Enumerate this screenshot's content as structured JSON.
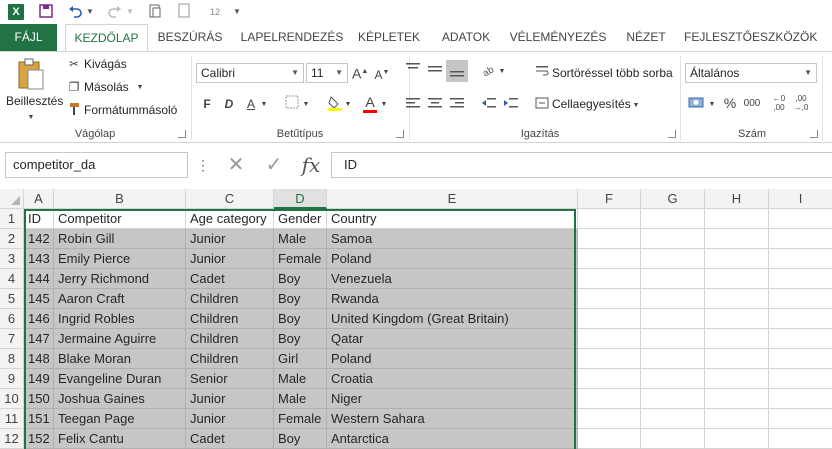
{
  "qat": {
    "app_icon": "X",
    "save_icon": "save-icon",
    "undo_icon": "undo-icon",
    "redo_icon": "redo-icon",
    "print_preview_icon": "print-preview-icon",
    "new_icon": "new-file-icon",
    "calendar_label": "12"
  },
  "tabs": [
    "FÁJL",
    "KEZDŐLAP",
    "BESZÚRÁS",
    "LAPELRENDEZÉS",
    "KÉPLETEK",
    "ADATOK",
    "VÉLEMÉNYEZÉS",
    "NÉZET",
    "FEJLESZTŐESZKÖZÖK"
  ],
  "ribbon": {
    "clipboard": {
      "paste": "Beillesztés",
      "cut": "Kivágás",
      "copy": "Másolás",
      "format_painter": "Formátummásoló",
      "label": "Vágólap"
    },
    "font": {
      "name": "Calibri",
      "size": "11",
      "grow": "A",
      "shrink": "A",
      "bold": "F",
      "italic": "D",
      "underline": "A",
      "font_color": "A",
      "label": "Betűtípus",
      "fill_color": "#ffff00",
      "text_color": "#ff0000"
    },
    "alignment": {
      "sort_label": "Sortöréssel több sorba",
      "merge_label": "Cellaegyesítés",
      "label": "Igazítás"
    },
    "number": {
      "format": "Általános",
      "percent": "%",
      "thousands": "000",
      "label": "Szám"
    }
  },
  "formula_bar": {
    "name_box": "competitor_da",
    "formula": "ID",
    "fx": "fx"
  },
  "columns": [
    "A",
    "B",
    "C",
    "D",
    "E",
    "F",
    "G",
    "H",
    "I"
  ],
  "selected_column": "D",
  "rows": [
    [
      "ID",
      "Competitor",
      "Age category",
      "Gender",
      "Country"
    ],
    [
      "142",
      "Robin Gill",
      "Junior",
      "Male",
      "Samoa"
    ],
    [
      "143",
      "Emily Pierce",
      "Junior",
      "Female",
      "Poland"
    ],
    [
      "144",
      "Jerry Richmond",
      "Cadet",
      "Boy",
      "Venezuela"
    ],
    [
      "145",
      "Aaron Craft",
      "Children",
      "Boy",
      "Rwanda"
    ],
    [
      "146",
      "Ingrid Robles",
      "Children",
      "Boy",
      "United Kingdom (Great Britain)"
    ],
    [
      "147",
      "Jermaine Aguirre",
      "Children",
      "Boy",
      "Qatar"
    ],
    [
      "148",
      "Blake Moran",
      "Children",
      "Girl",
      "Poland"
    ],
    [
      "149",
      "Evangeline Duran",
      "Senior",
      "Male",
      "Croatia"
    ],
    [
      "150",
      "Joshua Gaines",
      "Junior",
      "Male",
      "Niger"
    ],
    [
      "151",
      "Teegan Page",
      "Junior",
      "Female",
      "Western Sahara"
    ],
    [
      "152",
      "Felix Cantu",
      "Cadet",
      "Boy",
      "Antarctica"
    ]
  ],
  "row_numbers": [
    "1",
    "2",
    "3",
    "4",
    "5",
    "6",
    "7",
    "8",
    "9",
    "10",
    "11",
    "12"
  ],
  "colors": {
    "accent": "#217346",
    "selection": "#c6c6c6"
  }
}
